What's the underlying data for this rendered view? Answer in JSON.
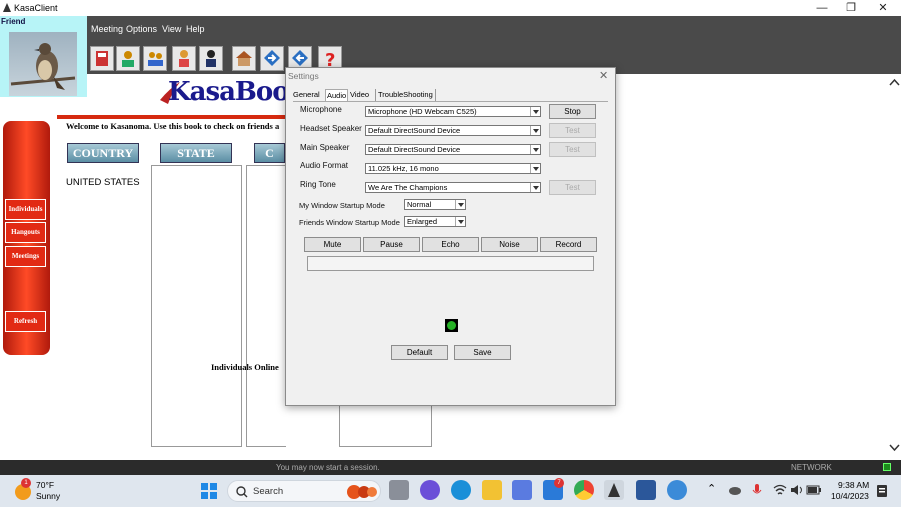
{
  "window": {
    "title": "KasaClient",
    "minimize": "—",
    "maximize": "❐",
    "close": "✕"
  },
  "menu": [
    "Meeting",
    "Options",
    "View",
    "Help"
  ],
  "friend": {
    "label": "Friend"
  },
  "kasabook": {
    "logo_text": "KasaBook",
    "welcome": "Welcome to Kasanoma. Use this book to check on friends a"
  },
  "columns": {
    "country": "COUNTRY",
    "state": "STATE",
    "city_partial": "C",
    "country_value": "UNITED STATES",
    "individuals_online": "Individuals Online"
  },
  "sidebar": [
    "Individuals",
    "Hangouts",
    "Meetings",
    "Refresh"
  ],
  "status": {
    "message": "You may now start a session.",
    "network": "NETWORK"
  },
  "dialog": {
    "title": "Settings",
    "tabs": [
      "General",
      "Audio",
      "Video",
      "TroubleShooting"
    ],
    "active_tab": "Audio",
    "fields": [
      {
        "label": "Microphone",
        "value": "Microphone (HD Webcam C525)",
        "button": "Stop",
        "enabled": true
      },
      {
        "label": "Headset Speaker",
        "value": "Default DirectSound Device",
        "button": "Test",
        "enabled": false
      },
      {
        "label": "Main Speaker",
        "value": "Default DirectSound Device",
        "button": "Test",
        "enabled": false
      },
      {
        "label": "Audio Format",
        "value": "11.025 kHz, 16 mono",
        "button": "",
        "enabled": false
      },
      {
        "label": "Ring Tone",
        "value": "We Are The Champions",
        "button": "Test",
        "enabled": false
      }
    ],
    "my_window_label": "My Window Startup Mode",
    "my_window_value": "Normal",
    "friends_window_label": "Friends Window Startup Mode",
    "friends_window_value": "Enlarged",
    "actions": [
      "Mute",
      "Pause",
      "Echo",
      "Noise",
      "Record"
    ],
    "default_button": "Default",
    "save_button": "Save"
  },
  "taskbar": {
    "weather_temp": "70°F",
    "weather_desc": "Sunny",
    "weather_badge": "1",
    "search": "Search",
    "mail_badge": "7",
    "time": "9:38 AM",
    "date": "10/4/2023"
  }
}
